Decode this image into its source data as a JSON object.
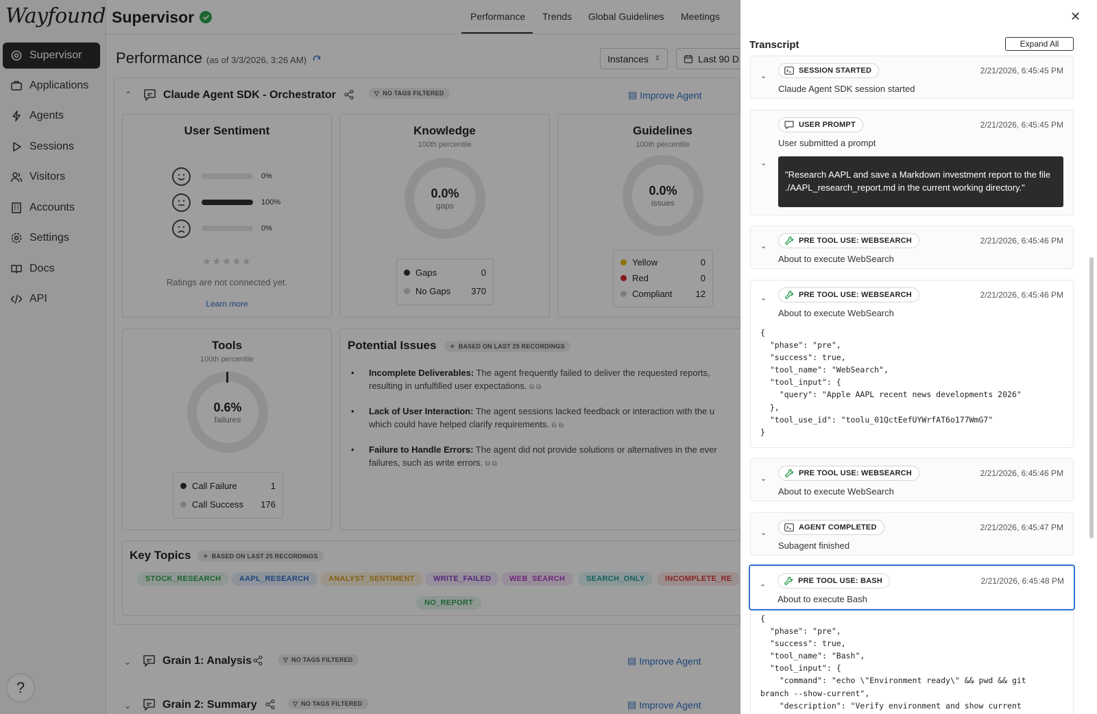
{
  "sidebar": {
    "logo": "Wayfound",
    "items": [
      {
        "label": "Supervisor",
        "icon": "gear-eye-icon",
        "active": true
      },
      {
        "label": "Applications",
        "icon": "briefcase-icon"
      },
      {
        "label": "Agents",
        "icon": "lightning-icon"
      },
      {
        "label": "Sessions",
        "icon": "play-icon"
      },
      {
        "label": "Visitors",
        "icon": "users-icon"
      },
      {
        "label": "Accounts",
        "icon": "building-icon"
      },
      {
        "label": "Settings",
        "icon": "gear-icon"
      },
      {
        "label": "Docs",
        "icon": "book-icon"
      },
      {
        "label": "API",
        "icon": "code-icon"
      }
    ],
    "help": "?"
  },
  "header": {
    "title": "Supervisor",
    "tabs": [
      "Performance",
      "Trends",
      "Global Guidelines",
      "Meetings"
    ],
    "active_tab": "Performance"
  },
  "performance": {
    "title": "Performance",
    "as_of": "(as of 3/3/2026, 3:26 AM)",
    "instances_label": "Instances",
    "range_label": "Last 90 D"
  },
  "agent": {
    "name": "Claude Agent SDK - Orchestrator",
    "tag_filter": "NO TAGS FILTERED",
    "improve": "Improve Agent",
    "sentiment": {
      "title": "User Sentiment",
      "rows": [
        {
          "face": "happy",
          "pct_label": "0%",
          "value": 0
        },
        {
          "face": "neutral",
          "pct_label": "100%",
          "value": 100
        },
        {
          "face": "sad",
          "pct_label": "0%",
          "value": 0
        }
      ],
      "stars": "★★★★★",
      "note": "Ratings are not connected yet.",
      "learn_more": "Learn more"
    },
    "knowledge": {
      "title": "Knowledge",
      "sub": "100th percentile",
      "value": "0.0%",
      "label": "gaps",
      "legend": [
        {
          "name": "Gaps",
          "count": "0",
          "color": "#333333"
        },
        {
          "name": "No Gaps",
          "count": "370",
          "color": "#cccccc"
        }
      ]
    },
    "guidelines": {
      "title": "Guidelines",
      "sub": "100th percentile",
      "value": "0.0%",
      "label": "issues",
      "legend": [
        {
          "name": "Yellow",
          "count": "0",
          "color": "#e6b800"
        },
        {
          "name": "Red",
          "count": "0",
          "color": "#d62b2b"
        },
        {
          "name": "Compliant",
          "count": "12",
          "color": "#cccccc"
        }
      ]
    },
    "tools": {
      "title": "Tools",
      "sub": "100th percentile",
      "value": "0.6%",
      "label": "failures",
      "legend": [
        {
          "name": "Call Failure",
          "count": "1",
          "color": "#333333"
        },
        {
          "name": "Call Success",
          "count": "176",
          "color": "#cccccc"
        }
      ]
    },
    "issues": {
      "title": "Potential Issues",
      "badge": "BASED ON LAST 25 RECORDINGS",
      "items": [
        {
          "head": "Incomplete Deliverables:",
          "line1": " The agent frequently failed to deliver the requested reports,",
          "line2": "resulting in unfulfilled user expectations."
        },
        {
          "head": "Lack of User Interaction:",
          "line1": " The agent sessions lacked feedback or interaction with the u",
          "line2": "which could have helped clarify requirements."
        },
        {
          "head": "Failure to Handle Errors:",
          "line1": " The agent did not provide solutions or alternatives in the ever",
          "line2": "failures, such as write errors."
        }
      ]
    },
    "key_topics": {
      "title": "Key Topics",
      "badge": "BASED ON LAST 25 RECORDINGS",
      "topics": [
        {
          "label": "STOCK_RESEARCH",
          "color": "#2e9e4f",
          "bg": "#e5f4ea"
        },
        {
          "label": "AAPL_RESEARCH",
          "color": "#2f6fc4",
          "bg": "#e6eefa"
        },
        {
          "label": "ANALYST_SENTIMENT",
          "color": "#d49a1f",
          "bg": "#faf1dd"
        },
        {
          "label": "WRITE_FAILED",
          "color": "#8a3fc4",
          "bg": "#f1e8fa"
        },
        {
          "label": "WEB_SEARCH",
          "color": "#b03fc4",
          "bg": "#f6e6f8"
        },
        {
          "label": "SEARCH_ONLY",
          "color": "#1f9a9a",
          "bg": "#e2f4f4"
        },
        {
          "label": "INCOMPLETE_RE",
          "color": "#d63a3a",
          "bg": "#fbe6e6"
        },
        {
          "label": "NO_REPORT",
          "color": "#2e9e4f",
          "bg": "#e5f4ea"
        }
      ]
    }
  },
  "grains": [
    {
      "name": "Grain 1: Analysis",
      "tag_filter": "NO TAGS FILTERED",
      "improve": "Improve Agent"
    },
    {
      "name": "Grain 2: Summary",
      "tag_filter": "NO TAGS FILTERED",
      "improve": "Improve Agent"
    }
  ],
  "transcript": {
    "title": "Transcript",
    "expand_all": "Expand All",
    "close": "✕",
    "events": [
      {
        "badge": "SESSION STARTED",
        "icon": "terminal-icon",
        "time": "2/21/2026, 6:45:45 PM",
        "desc": "Claude Agent SDK session started",
        "expanded": false
      },
      {
        "badge": "USER PROMPT",
        "icon": "chat-icon",
        "time": "2/21/2026, 6:45:45 PM",
        "desc": "User submitted a prompt",
        "prompt": "\"Research AAPL and save a Markdown investment report to the file ./AAPL_research_report.md in the current working directory.\"",
        "expanded": false
      },
      {
        "badge": "PRE TOOL USE: WEBSEARCH",
        "icon": "wrench-icon",
        "time": "2/21/2026, 6:45:46 PM",
        "desc": "About to execute WebSearch",
        "expanded": false
      },
      {
        "badge": "PRE TOOL USE: WEBSEARCH",
        "icon": "wrench-icon",
        "time": "2/21/2026, 6:45:46 PM",
        "desc": "About to execute WebSearch",
        "expanded": true,
        "json": "{\n  \"phase\": \"pre\",\n  \"success\": true,\n  \"tool_name\": \"WebSearch\",\n  \"tool_input\": {\n    \"query\": \"Apple AAPL recent news developments 2026\"\n  },\n  \"tool_use_id\": \"toolu_01QctEefUYWrfAT6o177WmG7\"\n}"
      },
      {
        "badge": "PRE TOOL USE: WEBSEARCH",
        "icon": "wrench-icon",
        "time": "2/21/2026, 6:45:46 PM",
        "desc": "About to execute WebSearch",
        "expanded": false
      },
      {
        "badge": "AGENT COMPLETED",
        "icon": "terminal-icon",
        "time": "2/21/2026, 6:45:47 PM",
        "desc": "Subagent finished",
        "expanded": false
      },
      {
        "badge": "PRE TOOL USE: BASH",
        "icon": "wrench-icon",
        "time": "2/21/2026, 6:45:48 PM",
        "desc": "About to execute Bash",
        "expanded": true,
        "selected": true,
        "json": "{\n  \"phase\": \"pre\",\n  \"success\": true,\n  \"tool_name\": \"Bash\",\n  \"tool_input\": {\n    \"command\": \"echo \\\"Environment ready\\\" && pwd && git\nbranch --show-current\",\n    \"description\": \"Verify environment and show current"
      }
    ]
  }
}
